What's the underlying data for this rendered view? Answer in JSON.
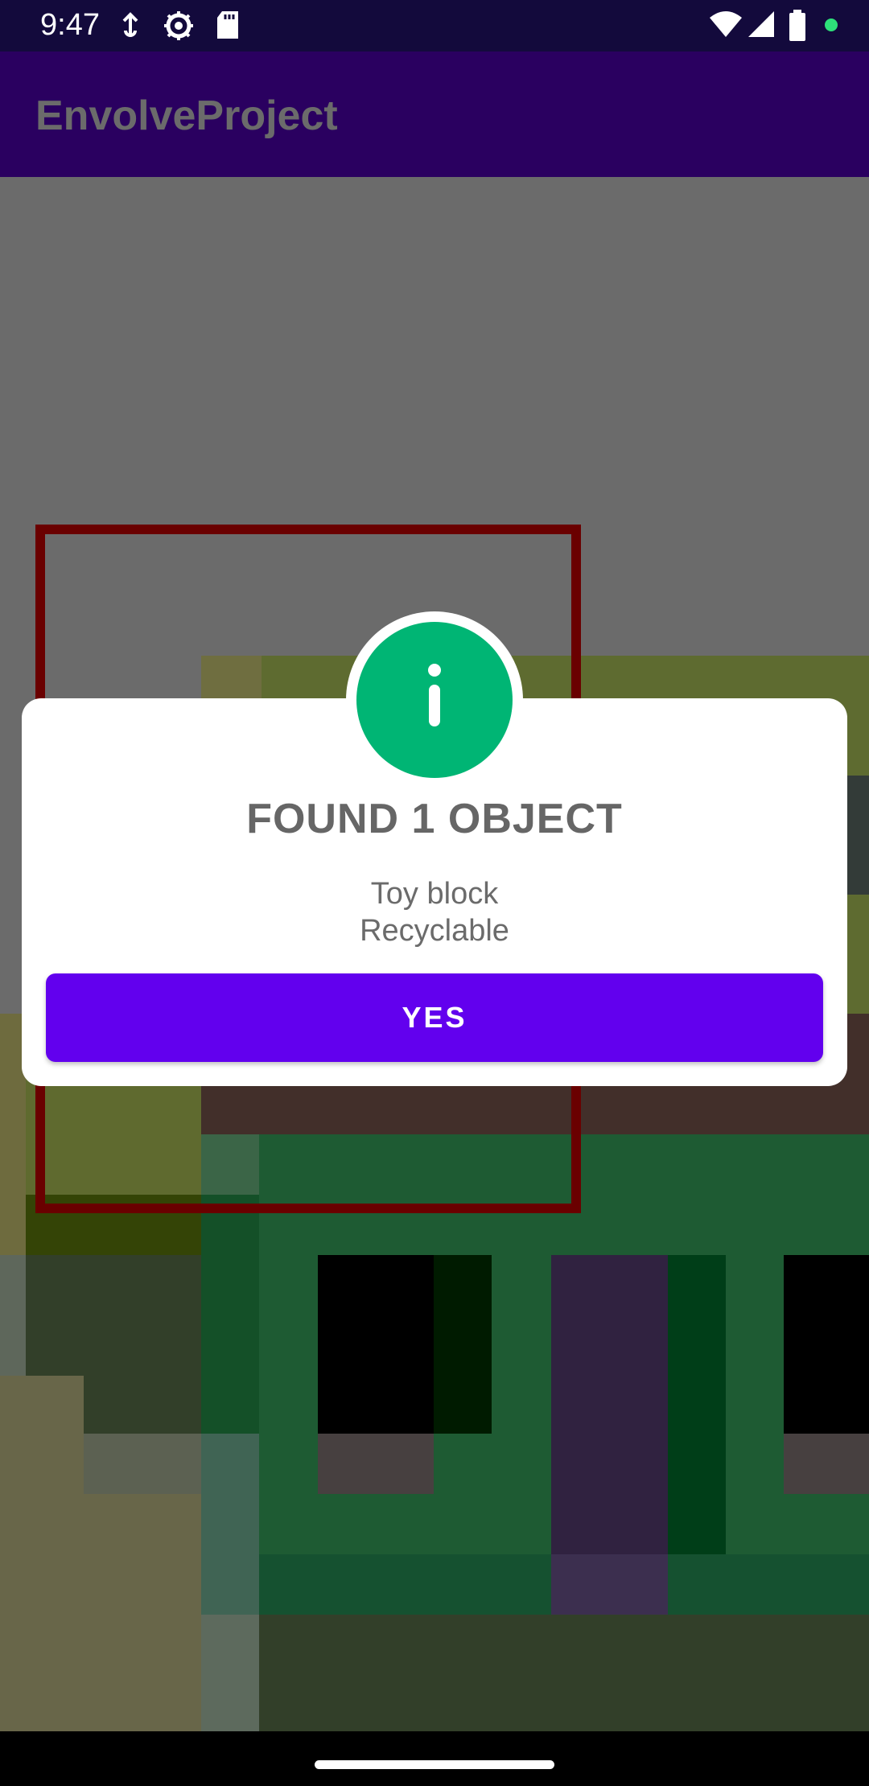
{
  "status_bar": {
    "time": "9:47",
    "icons_left": [
      "usb-debug-icon",
      "settings-gear-icon",
      "sd-card-icon"
    ],
    "icons_right": [
      "wifi-icon",
      "cell-signal-icon",
      "battery-icon",
      "green-dot-indicator"
    ]
  },
  "app_bar": {
    "title": "EnvolveProject"
  },
  "dialog": {
    "icon": "info-icon",
    "title": "FOUND 1 OBJECT",
    "line1": "Toy block",
    "line2": "Recyclable",
    "confirm_label": "YES"
  },
  "colors": {
    "app_bar": "#2a0060",
    "status_bar": "#130a3c",
    "accent_button": "#6200ee",
    "info_icon": "#00b574",
    "detection_box": "#6a0000"
  }
}
